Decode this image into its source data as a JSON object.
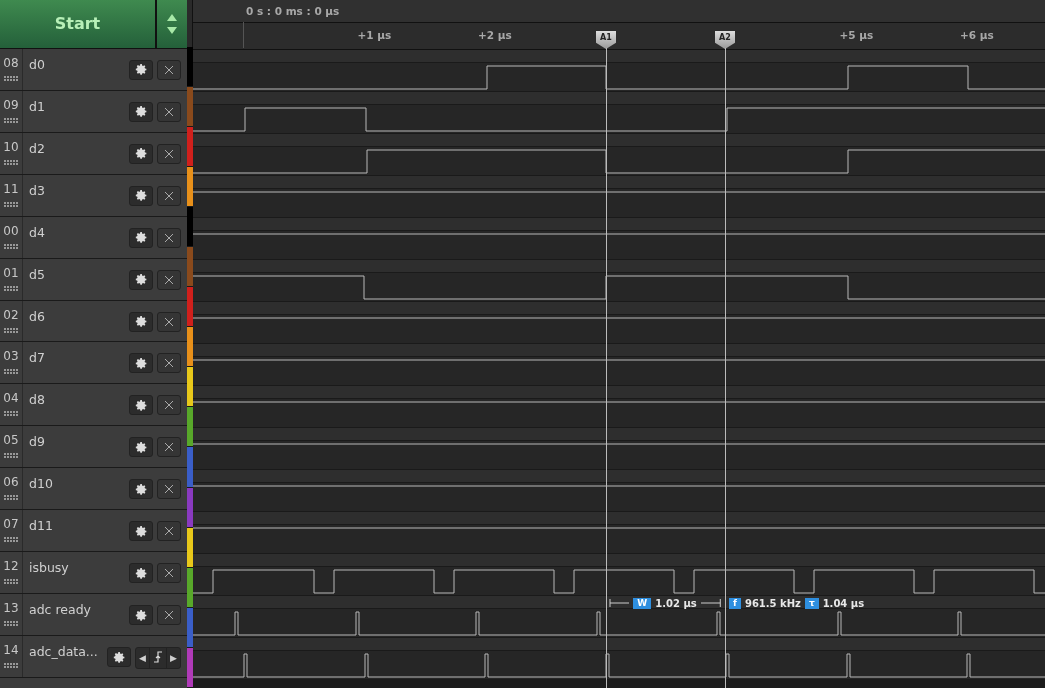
{
  "start_button": {
    "label": "Start"
  },
  "time_readout": "0 s : 0 ms : 0 µs",
  "ticks": [
    "+1 µs",
    "+2 µs",
    "+5 µs",
    "+6 µs"
  ],
  "cursors": [
    {
      "label": "A1"
    },
    {
      "label": "A2"
    }
  ],
  "channels": [
    {
      "number": "08",
      "name": "d0",
      "color": "#000000",
      "kind": "digital"
    },
    {
      "number": "09",
      "name": "d1",
      "color": "#8a4a1c",
      "kind": "digital"
    },
    {
      "number": "10",
      "name": "d2",
      "color": "#d0201c",
      "kind": "digital"
    },
    {
      "number": "11",
      "name": "d3",
      "color": "#e8901a",
      "kind": "digital"
    },
    {
      "number": "00",
      "name": "d4",
      "color": "#000000",
      "kind": "digital"
    },
    {
      "number": "01",
      "name": "d5",
      "color": "#8a4a1c",
      "kind": "digital"
    },
    {
      "number": "02",
      "name": "d6",
      "color": "#d0201c",
      "kind": "digital"
    },
    {
      "number": "03",
      "name": "d7",
      "color": "#e8901a",
      "kind": "digital"
    },
    {
      "number": "04",
      "name": "d8",
      "color": "#e8c81a",
      "kind": "digital"
    },
    {
      "number": "05",
      "name": "d9",
      "color": "#58a82a",
      "kind": "digital"
    },
    {
      "number": "06",
      "name": "d10",
      "color": "#3a5ec8",
      "kind": "digital"
    },
    {
      "number": "07",
      "name": "d11",
      "color": "#8a3ac0",
      "kind": "digital"
    },
    {
      "number": "12",
      "name": "isbusy",
      "color": "#e8c81a",
      "kind": "digital"
    },
    {
      "number": "13",
      "name": "adc ready",
      "color": "#58a82a",
      "kind": "digital"
    },
    {
      "number": "14",
      "name": "adc_data...",
      "color": "#3a5ec8",
      "kind": "analyzer",
      "nav": {
        "prev": "◀",
        "next": "▶"
      }
    }
  ],
  "measurement": {
    "width_badge": "W",
    "width": "1.02 µs",
    "freq_badge": "f",
    "frequency": "961.5 kHz",
    "period_badge": "τ",
    "period": "1.04 µs"
  }
}
